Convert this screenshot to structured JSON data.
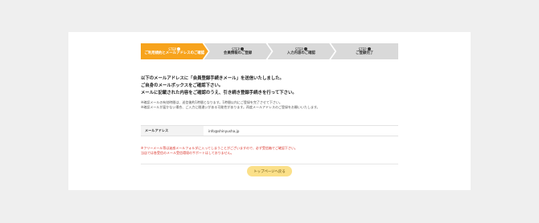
{
  "steps": [
    {
      "step_no": "STEP",
      "num": "1",
      "label": "ご利用規約とメールアドレスのご確認",
      "active": true
    },
    {
      "step_no": "STEP",
      "num": "2",
      "label": "会員情報のご登録",
      "active": false
    },
    {
      "step_no": "STEP",
      "num": "3",
      "label": "入力内容のご確認",
      "active": false
    },
    {
      "step_no": "STEP",
      "num": "4",
      "label": "ご登録完了",
      "active": false
    }
  ],
  "message": {
    "line1": "以下のメールアドレスに「会員登録手続きメール」を送信いたしました。",
    "line2": "ご自身のメールボックスをご確認下さい。",
    "line3": "メールに記載された内容をご確認のうえ、引き続き登録手続きを行って下さい。"
  },
  "notes": {
    "line1": "※確認メールの有効時間は、送信後約1時間となります。1時間以内にご登録を完了させて下さい。",
    "line2": "※確認メールが届かない場合、ご入力に間違いがある可能性があります。再度メールアドレスのご登録をお願いいたします。"
  },
  "form": {
    "label": "メールアドレス",
    "value": "info@shinyusha.jp"
  },
  "warning": {
    "line1": "※フリーメール等は迷惑メールフォルダに入ってしまうことがございますので、必ず受信箱でご確認下さい。",
    "line2": "当店では各受信のメール受信環境のサポートはしておりません。"
  },
  "button": {
    "label": "トップページへ戻る"
  },
  "colors": {
    "accent": "#f7a31c",
    "inactive": "#d9d9d9",
    "warning": "#d9342b",
    "button": "#fbe089"
  }
}
